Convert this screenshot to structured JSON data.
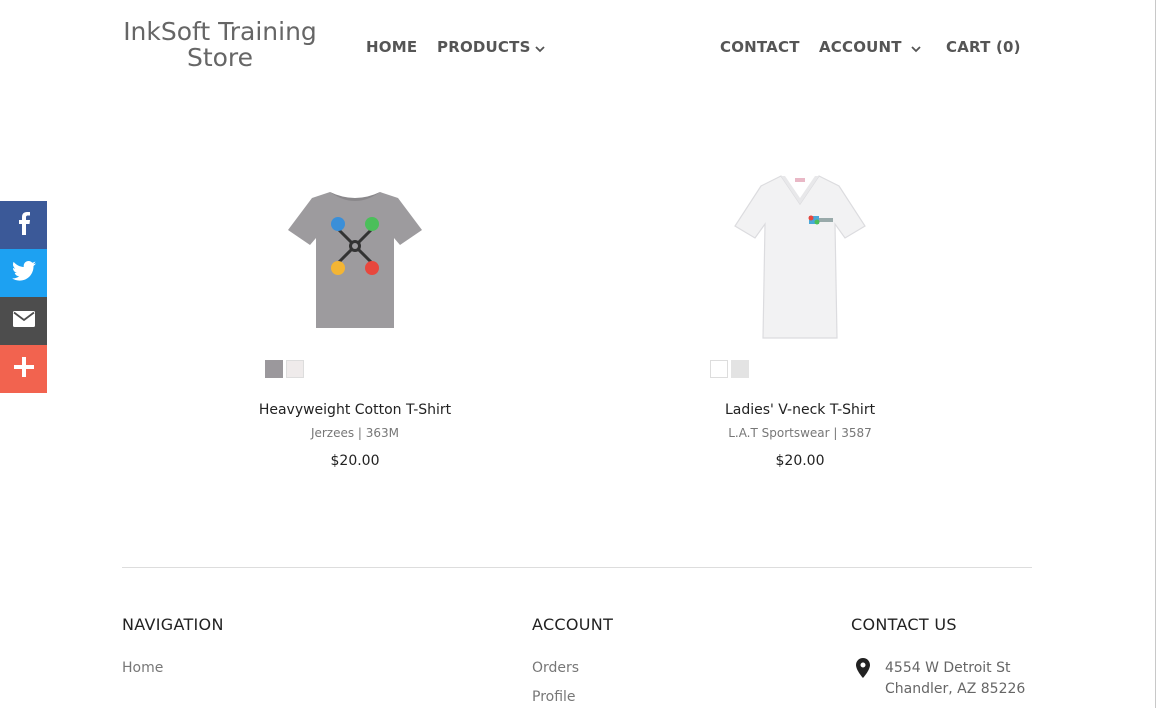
{
  "header": {
    "logo_line1": "InkSoft Training",
    "logo_line2": "Store",
    "nav": {
      "home": "HOME",
      "products": "PRODUCTS",
      "contact": "CONTACT",
      "account": "ACCOUNT",
      "cart": "CART (0)"
    }
  },
  "social": {
    "icons": [
      "facebook-icon",
      "twitter-icon",
      "email-icon",
      "plus-icon"
    ],
    "colors": {
      "facebook": "#3b5998",
      "twitter": "#1da1f2",
      "email": "#4d4d4d",
      "share": "#f2634f"
    }
  },
  "products": [
    {
      "name": "Heavyweight Cotton T-Shirt",
      "brand": "Jerzees | 363M",
      "price": "$20.00",
      "swatches": [
        "#9b989c",
        "#efebeb"
      ]
    },
    {
      "name": "Ladies' V-neck T-Shirt",
      "brand": "L.A.T Sportswear | 3587",
      "price": "$20.00",
      "swatches": [
        "#ffffff",
        "#e3e3e3"
      ]
    }
  ],
  "footer": {
    "navigation": {
      "heading": "NAVIGATION",
      "links": [
        "Home"
      ]
    },
    "account": {
      "heading": "ACCOUNT",
      "links": [
        "Orders",
        "Profile"
      ]
    },
    "contact": {
      "heading": "CONTACT US",
      "address_line1": "4554 W Detroit St",
      "address_line2": "Chandler, AZ 85226"
    }
  }
}
